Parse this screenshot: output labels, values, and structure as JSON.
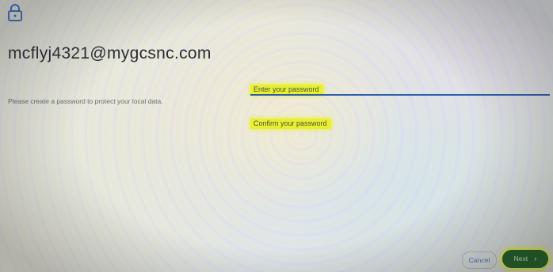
{
  "account": {
    "email": "mcflyj4321@mygcsnc.com",
    "description": "Please create a password to protect your local data."
  },
  "fields": [
    {
      "label": "Enter your password",
      "active": true
    },
    {
      "label": "Confirm your password",
      "active": false
    }
  ],
  "buttons": {
    "cancel": "Cancel",
    "next": "Next",
    "next_icon": "chevron-right-icon"
  },
  "icons": {
    "top_left": "lock-icon"
  },
  "colors": {
    "accent_blue": "#2f5ea8",
    "next_button": "#1d5e22",
    "highlight": "#e8f02c"
  }
}
